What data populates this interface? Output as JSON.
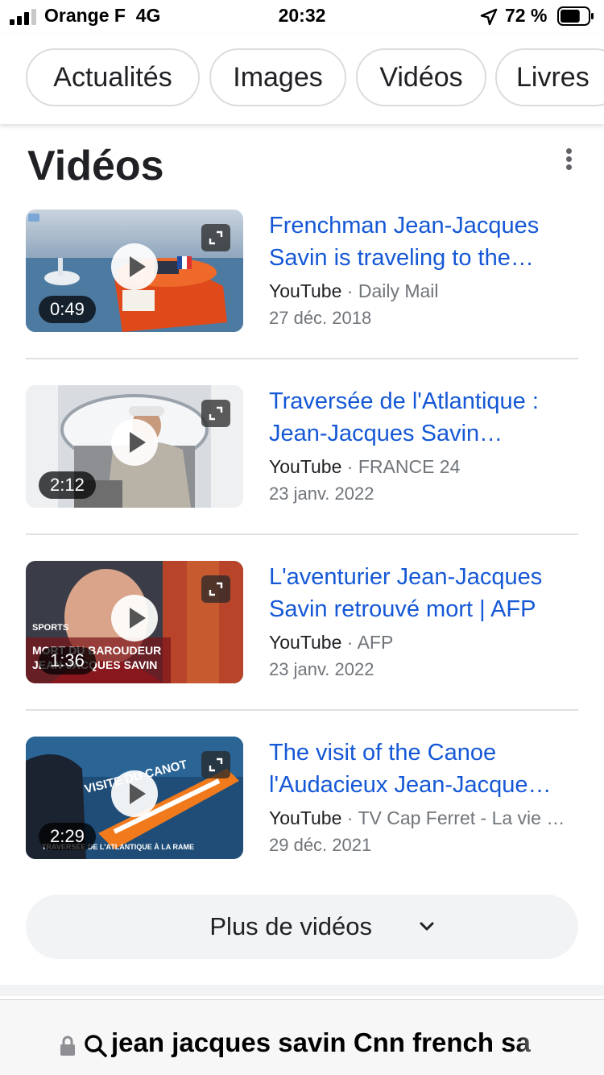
{
  "status_bar": {
    "carrier": "Orange F",
    "network": "4G",
    "time": "20:32",
    "battery_percent": "72 %",
    "battery_level": 0.72,
    "icons": [
      "signal-icon",
      "location-arrow-icon",
      "battery-icon"
    ]
  },
  "search_tabs": [
    {
      "label": "Actualités"
    },
    {
      "label": "Images"
    },
    {
      "label": "Vidéos"
    },
    {
      "label": "Livres"
    }
  ],
  "videos_section": {
    "title": "Vidéos",
    "more_menu_icon": "more-vert-icon",
    "items": [
      {
        "title_line1": "Frenchman Jean-Jacques",
        "title_line2": "Savin is traveling to the…",
        "platform": "YouTube",
        "separator": "·",
        "channel": "Daily Mail",
        "date": "27 déc. 2018",
        "duration": "0:49"
      },
      {
        "title_line1": "Traversée de l'Atlantique :",
        "title_line2": "Jean-Jacques Savin…",
        "platform": "YouTube",
        "separator": "·",
        "channel": "FRANCE 24",
        "date": "23 janv. 2022",
        "duration": "2:12"
      },
      {
        "title_line1": "L'aventurier Jean-Jacques",
        "title_line2": "Savin retrouvé mort | AFP",
        "platform": "YouTube",
        "separator": "·",
        "channel": "AFP",
        "date": "23 janv. 2022",
        "duration": "1:36",
        "thumb_text_top": "SPORTS",
        "thumb_text_line1": "MORT DU BAROUDEUR",
        "thumb_text_line2": "JEAN-JACQUES SAVIN"
      },
      {
        "title_line1": "The visit of the Canoe",
        "title_line2": "l'Audacieux Jean-Jacque…",
        "platform": "YouTube",
        "separator": "·",
        "channel": "TV Cap Ferret - La vie …",
        "date": "29 déc. 2021",
        "duration": "2:29",
        "thumb_text_top": "VISITE DU CANOT",
        "thumb_text_bottom": "TRAVERSÉE DE L'ATLANTIQUE À LA RAME"
      }
    ],
    "more_button_label": "Plus de vidéos"
  },
  "url_bar": {
    "query": "jean jacques savin Cnn french sa"
  },
  "colors": {
    "link": "#1558d6",
    "secondary_text": "#70757a",
    "chip_border": "#dadce0",
    "more_button_bg": "#f1f3f4"
  }
}
